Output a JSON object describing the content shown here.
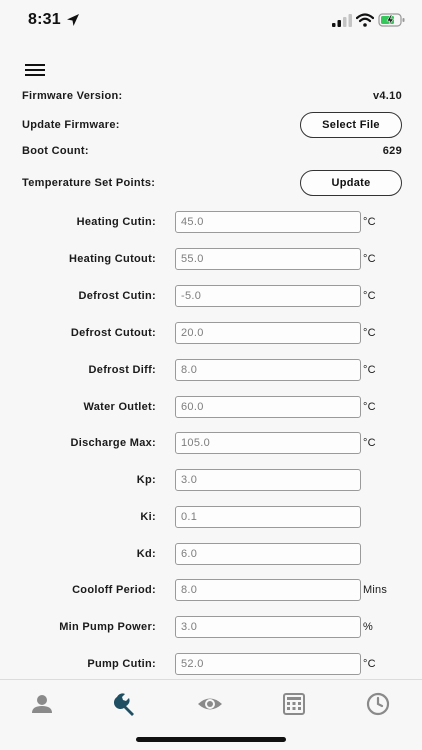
{
  "status_bar": {
    "time": "8:31",
    "icons": [
      "location-arrow-icon",
      "signal-icon",
      "wifi-icon",
      "battery-charging-icon"
    ]
  },
  "header": {
    "menu_icon": "hamburger-menu-icon"
  },
  "info": {
    "firmware_version_label": "Firmware Version:",
    "firmware_version_value": "v4.10",
    "update_firmware_label": "Update Firmware:",
    "select_file_label": "Select File",
    "boot_count_label": "Boot Count:",
    "boot_count_value": "629",
    "temp_set_points_label": "Temperature Set Points:",
    "update_label": "Update"
  },
  "params": [
    {
      "label": "Heating Cutin:",
      "value": "45.0",
      "unit": "°C"
    },
    {
      "label": "Heating Cutout:",
      "value": "55.0",
      "unit": "°C"
    },
    {
      "label": "Defrost Cutin:",
      "value": "-5.0",
      "unit": "°C"
    },
    {
      "label": "Defrost Cutout:",
      "value": "20.0",
      "unit": "°C"
    },
    {
      "label": "Defrost Diff:",
      "value": "8.0",
      "unit": "°C"
    },
    {
      "label": "Water Outlet:",
      "value": "60.0",
      "unit": "°C"
    },
    {
      "label": "Discharge Max:",
      "value": "105.0",
      "unit": "°C"
    },
    {
      "label": "Kp:",
      "value": "3.0",
      "unit": ""
    },
    {
      "label": "Ki:",
      "value": "0.1",
      "unit": ""
    },
    {
      "label": "Kd:",
      "value": "6.0",
      "unit": ""
    },
    {
      "label": "Cooloff Period:",
      "value": "8.0",
      "unit": "Mins"
    },
    {
      "label": "Min Pump Power:",
      "value": "3.0",
      "unit": "%"
    },
    {
      "label": "Pump Cutin:",
      "value": "52.0",
      "unit": "°C"
    }
  ],
  "tab_bar": {
    "tabs": [
      {
        "icon": "person-icon",
        "active": false
      },
      {
        "icon": "wrench-icon",
        "active": true
      },
      {
        "icon": "eye-icon",
        "active": false
      },
      {
        "icon": "calculator-icon",
        "active": false
      },
      {
        "icon": "clock-icon",
        "active": false
      }
    ],
    "active_color": "#1f4f63",
    "inactive_color": "#8a8a8a"
  }
}
